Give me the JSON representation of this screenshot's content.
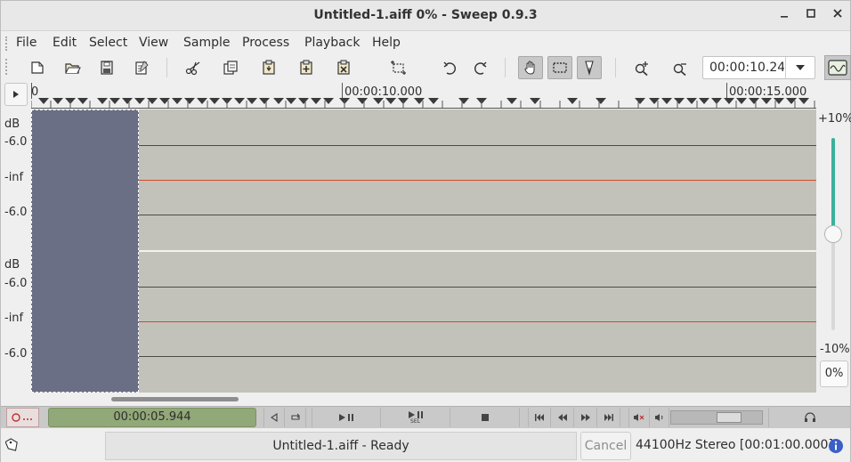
{
  "window": {
    "title": "Untitled-1.aiff 0% - Sweep 0.9.3",
    "minimize_icon": "minimize-icon",
    "maximize_icon": "maximize-icon",
    "close_icon": "close-icon"
  },
  "menu": {
    "items": [
      "File",
      "Edit",
      "Select",
      "View",
      "Sample",
      "Process",
      "Playback",
      "Help"
    ]
  },
  "toolbar": {
    "icons": [
      "new-file-icon",
      "open-file-icon",
      "save-icon",
      "properties-icon",
      "cut-icon",
      "copy-icon",
      "paste-icon",
      "paste-mix-icon",
      "paste-xfade-icon",
      "crop-icon",
      "undo-icon",
      "redo-icon",
      "hand-tool-icon",
      "select-tool-icon",
      "pencil-tool-icon",
      "zoom-in-icon",
      "zoom-out-icon",
      "scope-icon"
    ],
    "time_value": "00:00:10.240",
    "time_dropdown_icon": "chevron-down-icon"
  },
  "ruler": {
    "labels": [
      "0",
      "00:00:10.000",
      "00:00:15.000"
    ]
  },
  "channels": [
    {
      "labels": [
        "dB",
        "-6.0",
        "-inf",
        "-6.0"
      ]
    },
    {
      "labels": [
        "dB",
        "-6.0",
        "-inf",
        "-6.0"
      ]
    }
  ],
  "volume": {
    "top_label": "+10%",
    "bottom_label": "-10%",
    "percent": "0%",
    "level_fraction": 0.5
  },
  "transport": {
    "position": "00:00:05.944",
    "buttons": [
      "play-reverse-icon",
      "loop-icon",
      "play-pause-icon",
      "play-selection-icon",
      "stop-icon",
      "skip-start-icon",
      "rewind-icon",
      "fast-forward-icon",
      "skip-end-icon",
      "mute-icon",
      "volume-icon",
      "headphones-icon"
    ],
    "sel_sub": "SEL"
  },
  "status": {
    "message": "Untitled-1.aiff - Ready",
    "cancel": "Cancel",
    "info": "44100Hz Stereo [00:01:00.000]"
  },
  "colors": {
    "selection": "#6b6f85",
    "wave_bg": "#c3c2ba",
    "zero_line": "#d14a2a",
    "position_display": "#91a878",
    "volume_fill": "#3bb09a",
    "info_icon": "#3a5fc7"
  }
}
